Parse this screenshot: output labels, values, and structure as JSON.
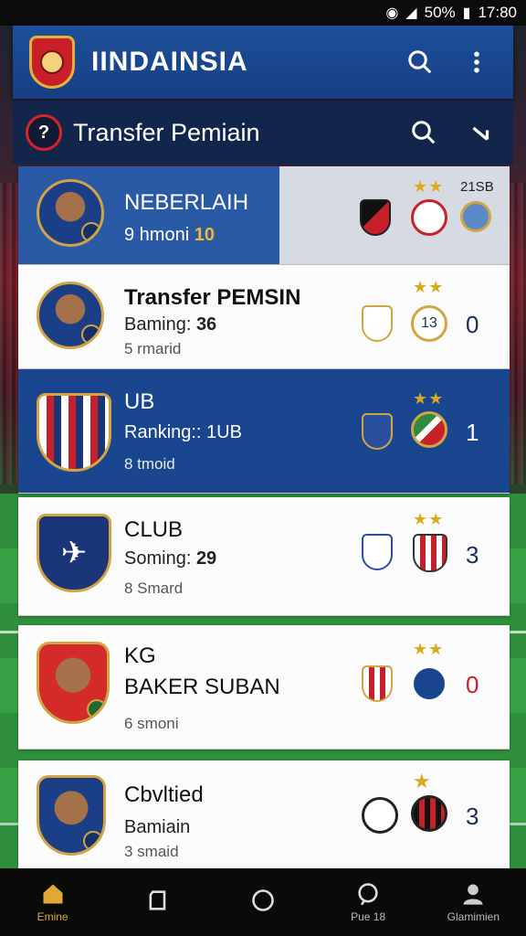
{
  "status_bar": {
    "battery": "50%",
    "time": "17:80"
  },
  "header": {
    "title": "IINDAINSIA"
  },
  "subheader": {
    "title": "Transfer Pemiain",
    "ball_label": "?"
  },
  "list": [
    {
      "name": "NEBERLAIH",
      "stat": "9 hmoni",
      "stat_value": "10",
      "sub": "",
      "stars": "★★",
      "score": "",
      "top_right": "21SB"
    },
    {
      "name": "Transfer PEMSIN",
      "stat": "Baming:",
      "stat_value": "36",
      "sub": "5 rmarid",
      "stars": "★★",
      "score": "0",
      "logo_text": "13"
    },
    {
      "name": "UB",
      "stat": "Ranking:: 1UB",
      "stat_value": "",
      "sub": "8 tmoid",
      "stars": "★★",
      "score": "1"
    },
    {
      "name": "CLUB",
      "stat": "Soming:",
      "stat_value": "29",
      "sub": "8 Smard",
      "stars": "★★",
      "score": "3"
    },
    {
      "name": "KG",
      "name2": "BAKER SUBAN",
      "stat": "",
      "stat_value": "",
      "sub": "6 smoni",
      "stars": "★★",
      "score": "0"
    },
    {
      "name": "Cbvltied",
      "stat": "Bamiain",
      "stat_value": "",
      "sub": "3 smaid",
      "stars": "★",
      "score": "3"
    }
  ],
  "bottom_nav": [
    {
      "label": "Emine",
      "icon": "home-icon"
    },
    {
      "label": "",
      "icon": "card-icon"
    },
    {
      "label": "",
      "icon": "circle-icon"
    },
    {
      "label": "Pue 18",
      "icon": "chat-icon"
    },
    {
      "label": "Glamimien",
      "icon": "user-icon"
    }
  ]
}
